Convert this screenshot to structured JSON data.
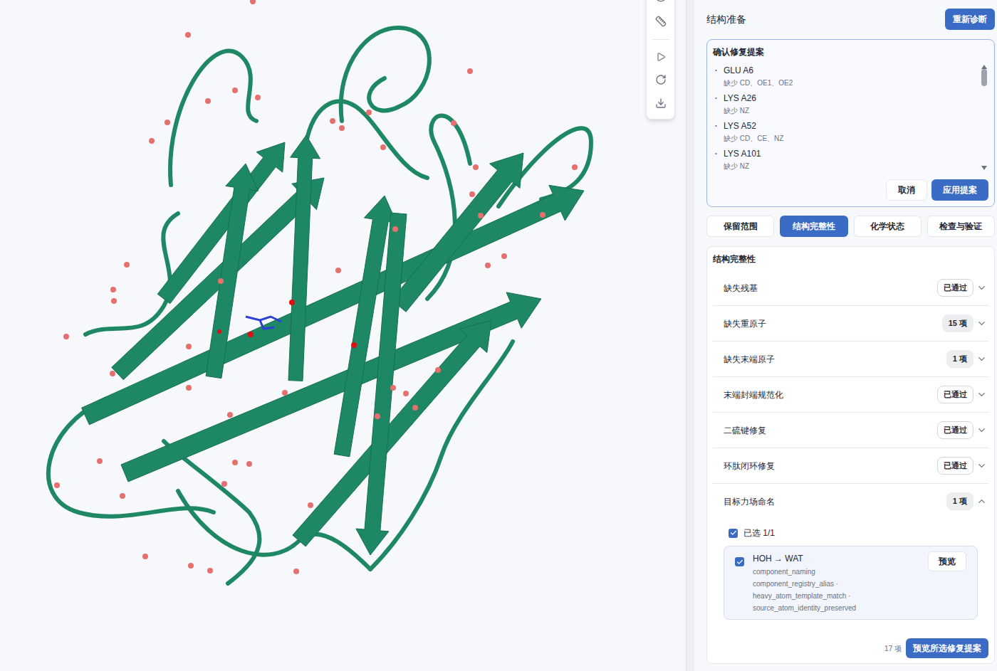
{
  "header": {
    "title": "结构准备",
    "button": "重新诊断"
  },
  "proposal": {
    "title": "确认修复提案",
    "scroll_level": 0,
    "items": [
      {
        "residue": "GLU A6",
        "detail": "缺少 CD、OE1、OE2"
      },
      {
        "residue": "LYS A26",
        "detail": "缺少 NZ"
      },
      {
        "residue": "LYS A52",
        "detail": "缺少 CD、CE、NZ"
      },
      {
        "residue": "LYS A101",
        "detail": "缺少 NZ"
      }
    ],
    "buttons": [
      {
        "label": "取消",
        "primary": false
      },
      {
        "label": "应用提案",
        "primary": true
      }
    ]
  },
  "tabs": [
    {
      "label": "保留范围",
      "selected": false
    },
    {
      "label": "结构完整性",
      "selected": true
    },
    {
      "label": "化学状态",
      "selected": false
    },
    {
      "label": "检查与验证",
      "selected": false
    }
  ],
  "integrity": {
    "title": "结构完整性",
    "rows": [
      {
        "label": "缺失残基",
        "badge": "已通过",
        "passed": true,
        "expanded": false
      },
      {
        "label": "缺失重原子",
        "badge": "15 项",
        "passed": false,
        "expanded": false
      },
      {
        "label": "缺失末端原子",
        "badge": "1 项",
        "passed": false,
        "expanded": false
      },
      {
        "label": "末端封端规范化",
        "badge": "已通过",
        "passed": true,
        "expanded": false
      },
      {
        "label": "二硫键修复",
        "badge": "已通过",
        "passed": true,
        "expanded": false
      },
      {
        "label": "环肽闭环修复",
        "badge": "已通过",
        "passed": true,
        "expanded": false
      },
      {
        "label": "目标力场命名",
        "badge": "1 项",
        "passed": false,
        "expanded": true,
        "details": {
          "select_all": {
            "label": "已选 1/1",
            "checked": true
          },
          "items": [
            {
              "title": "HOH → WAT",
              "checked": true,
              "button": "预览",
              "tags": [
                "component_naming",
                "component_registry_alias ·",
                "heavy_atom_template_match ·",
                "source_atom_identity_preserved"
              ]
            }
          ]
        }
      }
    ],
    "footer": {
      "count": "17 项",
      "button": "预览所选修复提案"
    }
  }
}
